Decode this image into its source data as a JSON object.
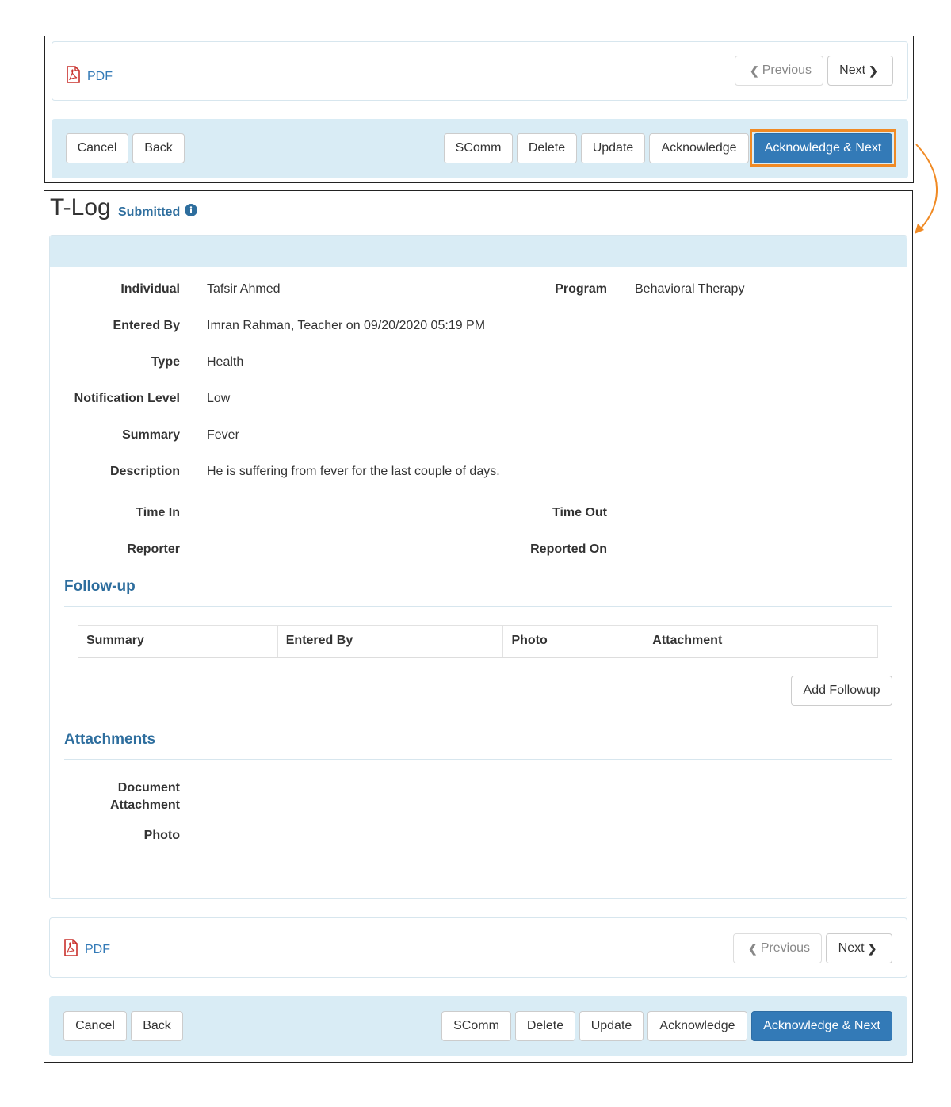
{
  "top_nav": {
    "pdf_label": "PDF",
    "previous_label": "Previous",
    "next_label": "Next"
  },
  "actions": {
    "cancel": "Cancel",
    "back": "Back",
    "scomm": "SComm",
    "delete": "Delete",
    "update": "Update",
    "acknowledge": "Acknowledge",
    "acknowledge_next": "Acknowledge & Next"
  },
  "header": {
    "title": "T-Log",
    "status": "Submitted"
  },
  "details": {
    "individual_label": "Individual",
    "individual_value": "Tafsir Ahmed",
    "program_label": "Program",
    "program_value": "Behavioral Therapy",
    "entered_by_label": "Entered By",
    "entered_by_value": "Imran Rahman, Teacher on 09/20/2020 05:19 PM",
    "type_label": "Type",
    "type_value": "Health",
    "notification_label": "Notification Level",
    "notification_value": "Low",
    "summary_label": "Summary",
    "summary_value": "Fever",
    "description_label": "Description",
    "description_value": "He is suffering from fever for the last couple of days.",
    "time_in_label": "Time In",
    "time_out_label": "Time Out",
    "reporter_label": "Reporter",
    "reported_on_label": "Reported On"
  },
  "followup": {
    "title": "Follow-up",
    "columns": [
      "Summary",
      "Entered By",
      "Photo",
      "Attachment"
    ],
    "add_button": "Add Followup"
  },
  "attachments": {
    "title": "Attachments",
    "document_label_line1": "Document",
    "document_label_line2": "Attachment",
    "photo_label": "Photo"
  },
  "colors": {
    "primary": "#337ab7",
    "highlight": "#f08a24",
    "panel_blue": "#d9ecf5",
    "section_title": "#2e6e9e"
  }
}
